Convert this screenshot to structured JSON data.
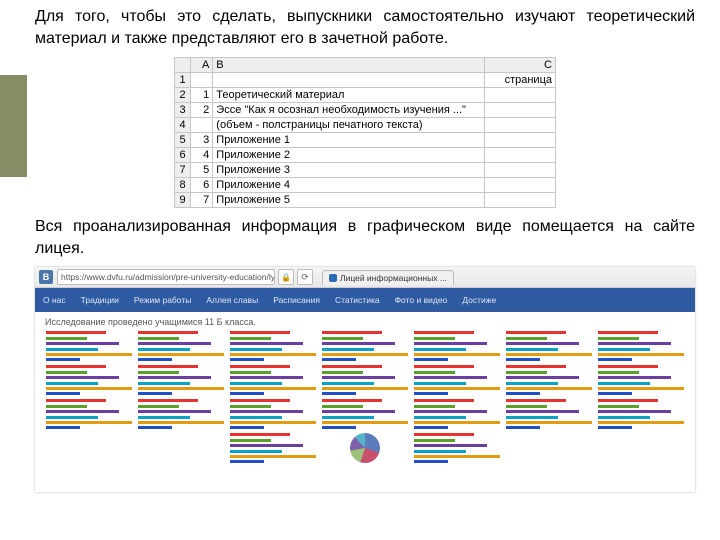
{
  "side_accent_color": "#868c65",
  "para1": "Для того, чтобы это сделать, выпускники самостоятельно изучают теоретический материал и также представляют его в зачетной работе.",
  "para2": "Вся проанализированная информация в графическом виде помещается на сайте лицея.",
  "spreadsheet": {
    "columns": [
      "",
      "A",
      "B",
      "C"
    ],
    "header_c": "страница",
    "rows": [
      {
        "rn": "1",
        "a": "",
        "b": "",
        "c": "страница"
      },
      {
        "rn": "2",
        "a": "1",
        "b": "Теоретический материал",
        "c": ""
      },
      {
        "rn": "3",
        "a": "2",
        "b": "Эссе \"Как я осознал необходимость изучения ...\"",
        "c": ""
      },
      {
        "rn": "4",
        "a": "",
        "b": "(объем - полстраницы печатного текста)",
        "c": ""
      },
      {
        "rn": "5",
        "a": "3",
        "b": "Приложение 1",
        "c": ""
      },
      {
        "rn": "6",
        "a": "4",
        "b": "Приложение 2",
        "c": ""
      },
      {
        "rn": "7",
        "a": "5",
        "b": "Приложение 3",
        "c": ""
      },
      {
        "rn": "8",
        "a": "6",
        "b": "Приложение 4",
        "c": ""
      },
      {
        "rn": "9",
        "a": "7",
        "b": "Приложение 5",
        "c": ""
      }
    ]
  },
  "browser": {
    "vk_label": "B",
    "url": "https://www.dvfu.ru/admission/pre-university-education/ly",
    "tab_title": "Лицей информационных ...",
    "nav": [
      "О нас",
      "Традиции",
      "Режим работы",
      "Аллея славы",
      "Расписания",
      "Статистика",
      "Фото и видео",
      "Достиже"
    ],
    "research_text": "Исследование проведено учащимися 11 Б класса.",
    "chart_rows": [
      7,
      7,
      7,
      3
    ]
  },
  "chart_data": {
    "type": "bar",
    "note": "screenshot shows a grid of ~24 small horizontal-bar thumbnails plus one pie thumbnail; individual values are not legible at this resolution",
    "approx_bar_series_per_thumbnail": 6,
    "approx_bar_lengths_fraction": [
      0.7,
      0.48,
      0.85,
      0.6,
      1.0,
      0.4
    ],
    "bar_colors": [
      "#e7332d",
      "#5aa02d",
      "#6b3fa0",
      "#0aa3c2",
      "#e39b0f",
      "#2250c4"
    ],
    "pie_slices_fraction": [
      0.3,
      0.25,
      0.17,
      0.16,
      0.12
    ],
    "pie_colors": [
      "#5b7dbb",
      "#c94f6e",
      "#9ec07a",
      "#7f63a8",
      "#56b4c9"
    ]
  }
}
